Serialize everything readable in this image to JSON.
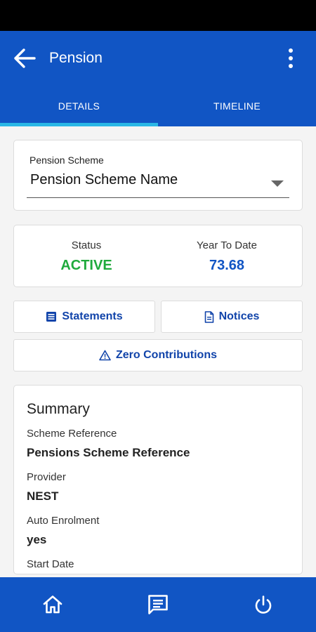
{
  "header": {
    "title": "Pension",
    "back_icon": "arrow-left-icon",
    "menu_icon": "more-vert-icon"
  },
  "tabs": [
    {
      "label": "DETAILS",
      "active": true
    },
    {
      "label": "TIMELINE",
      "active": false
    }
  ],
  "scheme_select": {
    "label": "Pension Scheme",
    "value": "Pension Scheme Name"
  },
  "status_card": {
    "status_label": "Status",
    "status_value": "ACTIVE",
    "ytd_label": "Year To Date",
    "ytd_value": "73.68"
  },
  "actions": {
    "statements": "Statements",
    "notices": "Notices",
    "zero_contributions": "Zero Contributions"
  },
  "summary": {
    "title": "Summary",
    "fields": [
      {
        "label": "Scheme Reference",
        "value": "Pensions Scheme Reference"
      },
      {
        "label": "Provider",
        "value": "NEST"
      },
      {
        "label": "Auto Enrolment",
        "value": "yes"
      },
      {
        "label": "Start Date",
        "value": ""
      }
    ]
  },
  "bottom_nav": {
    "items": [
      "home-icon",
      "message-icon",
      "power-icon"
    ]
  },
  "colors": {
    "primary": "#1155c4",
    "tab_indicator": "#2ab7e6",
    "active_status": "#1faa3c",
    "action_text": "#1144aa"
  }
}
